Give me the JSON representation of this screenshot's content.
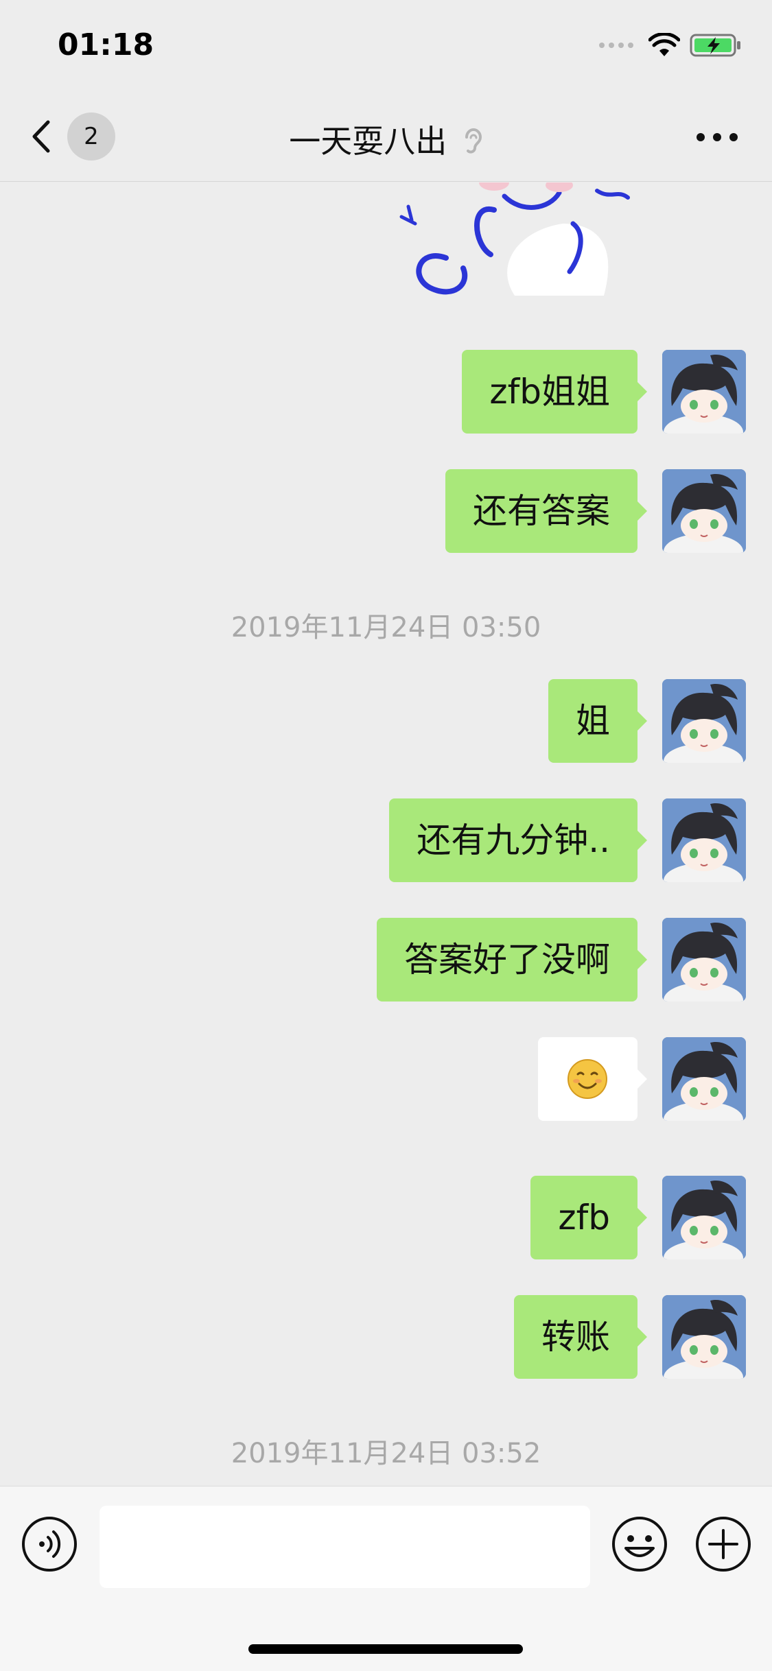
{
  "status_bar": {
    "time": "01:18"
  },
  "nav": {
    "unread_count": "2",
    "title": "一天耍八出"
  },
  "messages": [
    {
      "text": "zfb姐姐"
    },
    {
      "text": "还有答案"
    },
    {
      "text": "姐"
    },
    {
      "text": "还有九分钟.."
    },
    {
      "text": "答案好了没啊"
    },
    {
      "emoji": "smile-emoji"
    },
    {
      "text": "zfb"
    },
    {
      "text": "转账"
    }
  ],
  "timestamps": [
    "2019年11月24日 03:50",
    "2019年11月24日 03:52"
  ],
  "input": {
    "value": ""
  },
  "colors": {
    "background": "#ededed",
    "bubble_sent": "#a9e87a",
    "timestamp_text": "#a8a8a8",
    "avatar_background": "#6f95cc"
  }
}
